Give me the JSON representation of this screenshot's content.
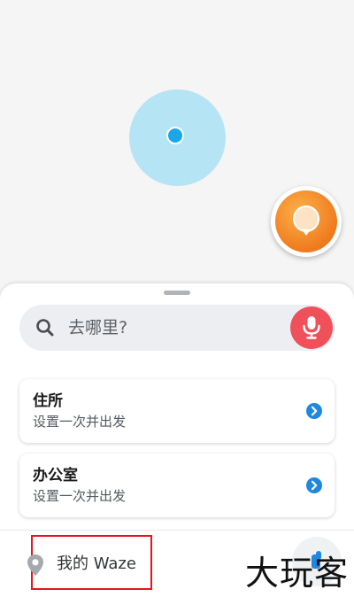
{
  "map": {
    "accuracy_color": "#b5e4f4",
    "location_color": "#1aa7e8",
    "report_button_icon": "report-bubble-icon"
  },
  "search": {
    "placeholder": "去哪里?",
    "icon": "search-icon",
    "mic_icon": "microphone-icon",
    "mic_color": "#f0505a"
  },
  "places": [
    {
      "title": "住所",
      "subtitle": "设置一次并出发",
      "icon": "chevron-right-icon"
    },
    {
      "title": "办公室",
      "subtitle": "设置一次并出发",
      "icon": "chevron-right-icon"
    }
  ],
  "bottom": {
    "my_waze_label": "我的 Waze",
    "pin_icon": "map-pin-icon",
    "highlight_color": "#e8141c"
  },
  "watermark": "大玩客"
}
